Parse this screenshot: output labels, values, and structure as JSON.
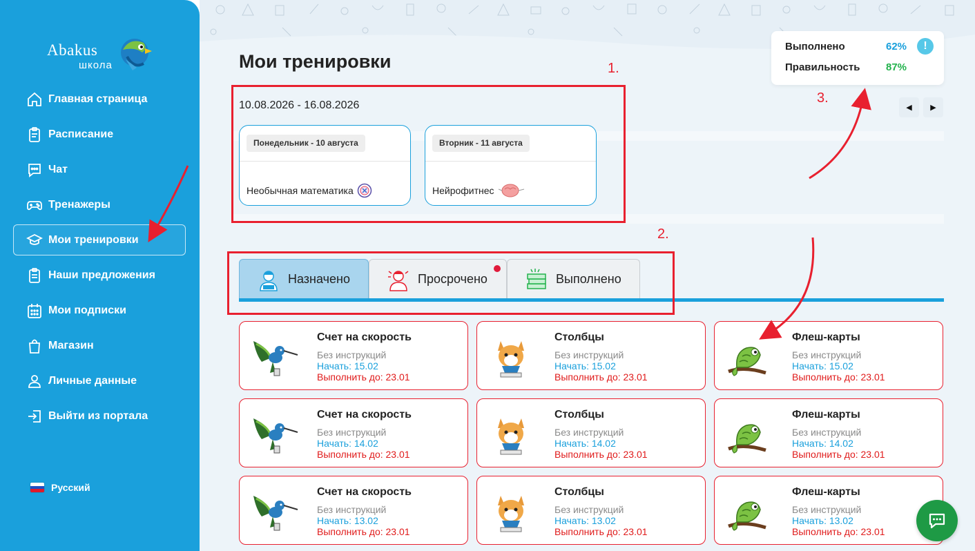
{
  "sidebar": {
    "logo": {
      "text": "Abakus",
      "sub": "школа"
    },
    "items": [
      {
        "label": "Главная страница",
        "icon": "home-icon",
        "active": false
      },
      {
        "label": "Расписание",
        "icon": "clipboard-icon",
        "active": false
      },
      {
        "label": "Чат",
        "icon": "chat-icon",
        "active": false
      },
      {
        "label": "Тренажеры",
        "icon": "gamepad-icon",
        "active": false
      },
      {
        "label": "Мои тренировки",
        "icon": "graduation-cap-icon",
        "active": true
      },
      {
        "label": "Наши предложения",
        "icon": "clipboard-list-icon",
        "active": false
      },
      {
        "label": "Мои подписки",
        "icon": "calendar-icon",
        "active": false
      },
      {
        "label": "Магазин",
        "icon": "shopping-bag-icon",
        "active": false
      },
      {
        "label": "Личные данные",
        "icon": "user-icon",
        "active": false
      },
      {
        "label": "Выйти из портала",
        "icon": "logout-icon",
        "active": false
      }
    ],
    "language": "Русский"
  },
  "main": {
    "title": "Мои тренировки",
    "stats": {
      "done_label": "Выполнено",
      "done_value": "62%",
      "accuracy_label": "Правильность",
      "accuracy_value": "87%"
    },
    "week": {
      "range": "10.08.2026 - 16.08.2026",
      "days": [
        {
          "day": "Понедельник - 10 августа",
          "lesson": "Необычная математика",
          "icon": "math-badge-icon"
        },
        {
          "day": "Вторник - 11 августа",
          "lesson": "Нейрофитнес",
          "icon": "brain-icon"
        }
      ]
    },
    "tabs": [
      {
        "label": "Назначено",
        "icon": "student-icon",
        "active": true,
        "dot": false
      },
      {
        "label": "Просрочено",
        "icon": "stressed-student-icon",
        "active": false,
        "dot": true
      },
      {
        "label": "Выполнено",
        "icon": "book-stack-icon",
        "active": false,
        "dot": false
      }
    ],
    "cards": [
      {
        "title": "Счет на скорость",
        "sub": "Без инструкций",
        "start": "Начать: 15.02",
        "due": "Выполнить до: 23.01",
        "icon": "hummingbird-icon"
      },
      {
        "title": "Столбцы",
        "sub": "Без инструкций",
        "start": "Начать: 15.02",
        "due": "Выполнить до: 23.01",
        "icon": "fox-icon"
      },
      {
        "title": "Флеш-карты",
        "sub": "Без инструкций",
        "start": "Начать: 15.02",
        "due": "Выполнить до: 23.01",
        "icon": "chameleon-icon"
      },
      {
        "title": "Счет на скорость",
        "sub": "Без инструкций",
        "start": "Начать: 14.02",
        "due": "Выполнить до: 23.01",
        "icon": "hummingbird-icon"
      },
      {
        "title": "Столбцы",
        "sub": "Без инструкций",
        "start": "Начать: 14.02",
        "due": "Выполнить до: 23.01",
        "icon": "fox-icon"
      },
      {
        "title": "Флеш-карты",
        "sub": "Без инструкций",
        "start": "Начать: 14.02",
        "due": "Выполнить до: 23.01",
        "icon": "chameleon-icon"
      },
      {
        "title": "Счет на скорость",
        "sub": "Без инструкций",
        "start": "Начать: 13.02",
        "due": "Выполнить до: 23.01",
        "icon": "hummingbird-icon"
      },
      {
        "title": "Столбцы",
        "sub": "Без инструкций",
        "start": "Начать: 13.02",
        "due": "Выполнить до: 23.01",
        "icon": "fox-icon"
      },
      {
        "title": "Флеш-карты",
        "sub": "Без инструкций",
        "start": "Начать: 13.02",
        "due": "Выполнить до: 23.01",
        "icon": "chameleon-icon"
      }
    ]
  },
  "annotations": {
    "n1": "1.",
    "n2": "2.",
    "n3": "3."
  },
  "colors": {
    "brand_blue": "#1aa0dc",
    "danger_red": "#e8202f",
    "success_green": "#1e9a45",
    "stat_blue": "#1aa0dc",
    "stat_green": "#22b24c"
  }
}
